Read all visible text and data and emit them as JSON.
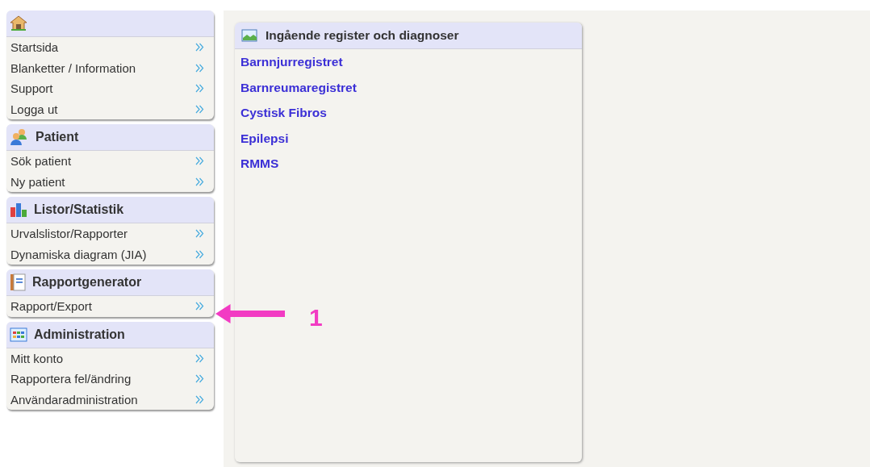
{
  "sidebar": {
    "sections": [
      {
        "kind": "home",
        "items": [
          "Startsida",
          "Blanketter / Information",
          "Support",
          "Logga ut"
        ]
      },
      {
        "kind": "people",
        "title": "Patient",
        "items": [
          "Sök patient",
          "Ny patient"
        ]
      },
      {
        "kind": "chart",
        "title": "Listor/Statistik",
        "items": [
          "Urvalslistor/Rapporter",
          "Dynamiska diagram (JIA)"
        ]
      },
      {
        "kind": "notebook",
        "title": "Rapportgenerator",
        "items": [
          "Rapport/Export"
        ]
      },
      {
        "kind": "grid",
        "title": "Administration",
        "items": [
          "Mitt konto",
          "Rapportera fel/ändring",
          "Användaradministration"
        ]
      }
    ]
  },
  "panel": {
    "title": "Ingående register och diagnoser",
    "links": [
      "Barnnjurregistret",
      "Barnreumaregistret",
      "Cystisk Fibros",
      "Epilepsi",
      "RMMS"
    ]
  },
  "callout": {
    "label": "1"
  }
}
